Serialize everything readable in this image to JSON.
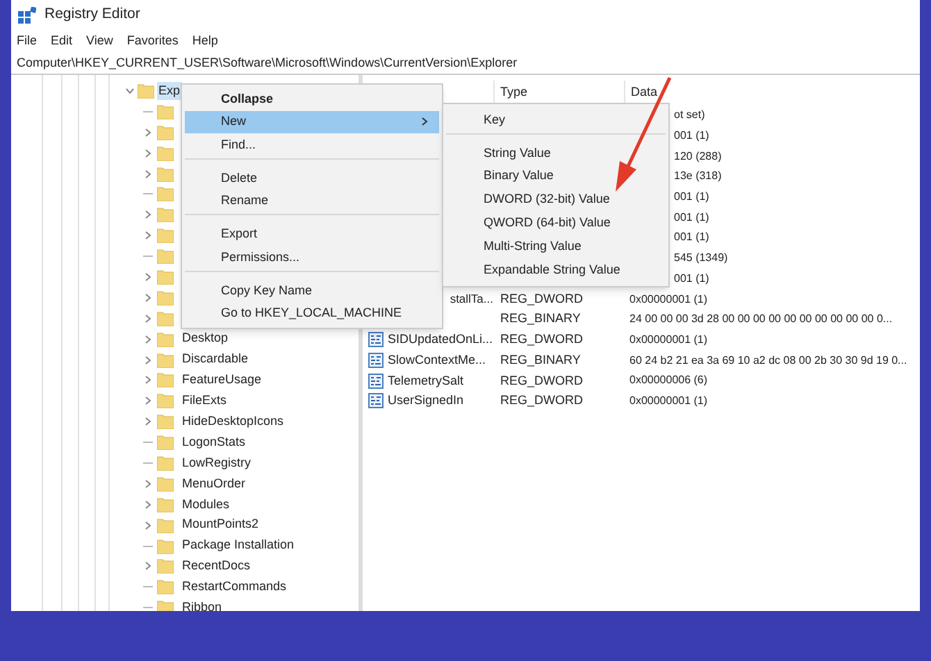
{
  "window": {
    "title": "Registry Editor"
  },
  "menu_bar": [
    "File",
    "Edit",
    "View",
    "Favorites",
    "Help"
  ],
  "address_bar": "Computer\\HKEY_CURRENT_USER\\Software\\Microsoft\\Windows\\CurrentVersion\\Explorer",
  "tree": {
    "label": "Exp",
    "expanded": true,
    "selected": true,
    "children": [
      {
        "expandable": false
      },
      {
        "expandable": true
      },
      {
        "expandable": true
      },
      {
        "expandable": true
      },
      {
        "expandable": false
      },
      {
        "expandable": true
      },
      {
        "expandable": true
      },
      {
        "expandable": false
      },
      {
        "expandable": true
      },
      {
        "expandable": true
      },
      {
        "expandable": true
      },
      {
        "label": "Desktop",
        "expandable": true,
        "selected": false
      },
      {
        "label": "Discardable",
        "expandable": true,
        "selected": false
      },
      {
        "label": "FeatureUsage",
        "expandable": true,
        "selected": false
      },
      {
        "label": "FileExts",
        "expandable": true,
        "selected": false
      },
      {
        "label": "HideDesktopIcons",
        "expandable": true,
        "selected": false
      },
      {
        "label": "LogonStats",
        "expandable": false,
        "selected": false
      },
      {
        "label": "LowRegistry",
        "expandable": false,
        "selected": false
      },
      {
        "label": "MenuOrder",
        "expandable": true,
        "selected": false
      },
      {
        "label": "Modules",
        "expandable": true,
        "selected": false
      },
      {
        "label": "MountPoints2",
        "expandable": true,
        "selected": false
      },
      {
        "label": "Package Installation",
        "expandable": false,
        "selected": false
      },
      {
        "label": "RecentDocs",
        "expandable": true,
        "selected": false
      },
      {
        "label": "RestartCommands",
        "expandable": false,
        "selected": false
      },
      {
        "label": "Ribbon",
        "expandable": false,
        "selected": false
      }
    ]
  },
  "values": {
    "columns": [
      "Type",
      "Data"
    ],
    "rows": [
      {
        "kind": "data_only",
        "data": "ot set)"
      },
      {
        "kind": "data_only",
        "data": "001 (1)"
      },
      {
        "kind": "data_only",
        "data": "120 (288)"
      },
      {
        "kind": "data_only",
        "data": "13e (318)"
      },
      {
        "kind": "data_only",
        "data": "001 (1)"
      },
      {
        "kind": "data_only",
        "data": "001 (1)"
      },
      {
        "kind": "data_only",
        "data": "001 (1)"
      },
      {
        "kind": "data_only",
        "data": "545 (1349)"
      },
      {
        "kind": "data_only",
        "data": "001 (1)"
      },
      {
        "kind": "partial_name",
        "name": "stallTa...",
        "type": "REG_DWORD",
        "data": "0x00000001 (1)"
      },
      {
        "kind": "type_only",
        "type": "REG_BINARY",
        "data": "24 00 00 00 3d 28 00 00 00 00 00 00 00 00 00 00 0..."
      },
      {
        "kind": "full",
        "name": "SIDUpdatedOnLi...",
        "type": "REG_DWORD",
        "data": "0x00000001 (1)"
      },
      {
        "kind": "full",
        "name": "SlowContextMe...",
        "type": "REG_BINARY",
        "data": "60 24 b2 21 ea 3a 69 10 a2 dc 08 00 2b 30 30 9d 19 0..."
      },
      {
        "kind": "full",
        "name": "TelemetrySalt",
        "type": "REG_DWORD",
        "data": "0x00000006 (6)"
      },
      {
        "kind": "full",
        "name": "UserSignedIn",
        "type": "REG_DWORD",
        "data": "0x00000001 (1)"
      }
    ]
  },
  "context_menu": [
    {
      "label": "Collapse",
      "default": true,
      "selected": false,
      "submenu": false,
      "separator_before": false
    },
    {
      "label": "New",
      "default": false,
      "selected": true,
      "submenu": true,
      "separator_before": false
    },
    {
      "label": "Find...",
      "default": false,
      "selected": false,
      "submenu": false,
      "separator_before": false
    },
    {
      "label": "Delete",
      "default": false,
      "selected": false,
      "submenu": false,
      "separator_before": true
    },
    {
      "label": "Rename",
      "default": false,
      "selected": false,
      "submenu": false,
      "separator_before": false
    },
    {
      "label": "Export",
      "default": false,
      "selected": false,
      "submenu": false,
      "separator_before": true
    },
    {
      "label": "Permissions...",
      "default": false,
      "selected": false,
      "submenu": false,
      "separator_before": false
    },
    {
      "label": "Copy Key Name",
      "default": false,
      "selected": false,
      "submenu": false,
      "separator_before": true
    },
    {
      "label": "Go to HKEY_LOCAL_MACHINE",
      "default": false,
      "selected": false,
      "submenu": false,
      "separator_before": false
    }
  ],
  "submenu": [
    {
      "label": "Key",
      "separator_before": false
    },
    {
      "label": "String Value",
      "separator_before": true
    },
    {
      "label": "Binary Value",
      "separator_before": false
    },
    {
      "label": "DWORD (32-bit) Value",
      "separator_before": false
    },
    {
      "label": "QWORD (64-bit) Value",
      "separator_before": false
    },
    {
      "label": "Multi-String Value",
      "separator_before": false
    },
    {
      "label": "Expandable String Value",
      "separator_before": false
    }
  ]
}
